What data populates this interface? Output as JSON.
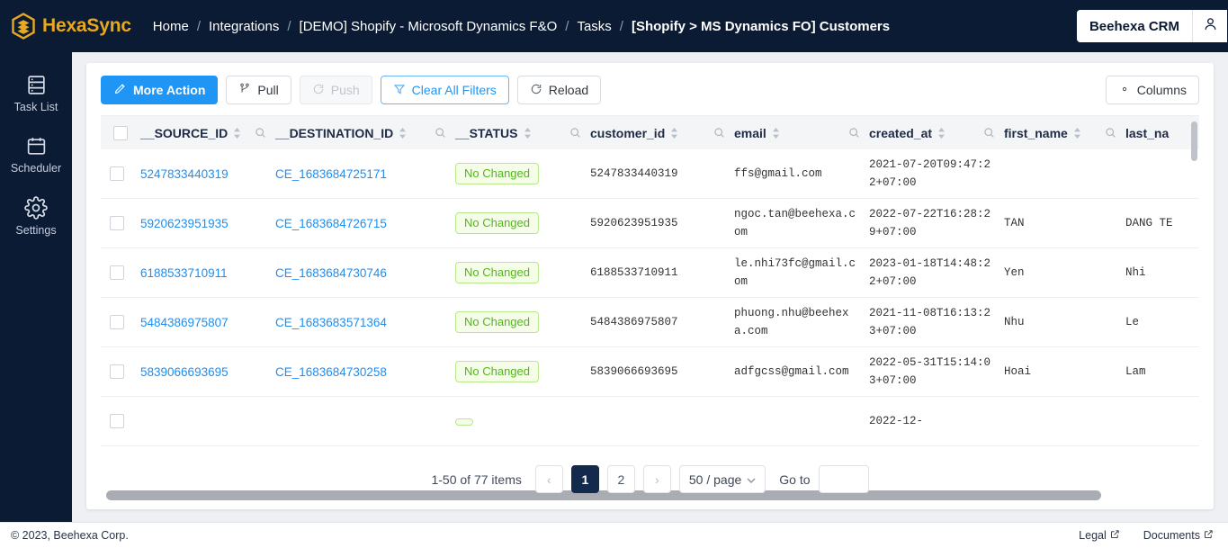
{
  "brand": {
    "name": "HexaSync",
    "logo_icon": "hexagon-layers-icon",
    "color": "#e8a820"
  },
  "breadcrumb": {
    "separator": "/",
    "items": [
      {
        "label": "Home",
        "current": false
      },
      {
        "label": "Integrations",
        "current": false
      },
      {
        "label": "[DEMO] Shopify - Microsoft Dynamics F&O",
        "current": false
      },
      {
        "label": "Tasks",
        "current": false
      },
      {
        "label": "[Shopify > MS Dynamics FO] Customers",
        "current": true
      }
    ]
  },
  "account": {
    "name": "Beehexa CRM",
    "avatar_icon": "user-icon"
  },
  "sidebar": {
    "items": [
      {
        "label": "Task List",
        "icon": "task-list-icon"
      },
      {
        "label": "Scheduler",
        "icon": "calendar-icon"
      },
      {
        "label": "Settings",
        "icon": "gear-icon"
      }
    ]
  },
  "toolbar": {
    "more_action": {
      "label": "More Action",
      "icon": "pen-icon"
    },
    "pull": {
      "label": "Pull",
      "icon": "branch-icon"
    },
    "push": {
      "label": "Push",
      "icon": "refresh-icon",
      "disabled": true
    },
    "clear_filters": {
      "label": "Clear All Filters",
      "icon": "filter-icon"
    },
    "reload": {
      "label": "Reload",
      "icon": "reload-icon"
    },
    "columns": {
      "label": "Columns",
      "icon": "gear-icon"
    }
  },
  "table": {
    "sort_icon": "sort-icon",
    "search_icon": "search-icon",
    "columns": [
      {
        "key": "source_id",
        "label": "__SOURCE_ID"
      },
      {
        "key": "destination_id",
        "label": "__DESTINATION_ID"
      },
      {
        "key": "status",
        "label": "__STATUS"
      },
      {
        "key": "customer_id",
        "label": "customer_id"
      },
      {
        "key": "email",
        "label": "email"
      },
      {
        "key": "created_at",
        "label": "created_at"
      },
      {
        "key": "first_name",
        "label": "first_name"
      },
      {
        "key": "last_name",
        "label": "last_na"
      }
    ],
    "rows": [
      {
        "source_id": "5247833440319",
        "destination_id": "CE_1683684725171",
        "status": "No Changed",
        "customer_id": "5247833440319",
        "email": "ffs@gmail.com",
        "created_at": "2021-07-20T09:47:22+07:00",
        "first_name": "",
        "last_name": ""
      },
      {
        "source_id": "5920623951935",
        "destination_id": "CE_1683684726715",
        "status": "No Changed",
        "customer_id": "5920623951935",
        "email": "ngoc.tan@beehexa.com",
        "created_at": "2022-07-22T16:28:29+07:00",
        "first_name": "TAN",
        "last_name": "DANG TE"
      },
      {
        "source_id": "6188533710911",
        "destination_id": "CE_1683684730746",
        "status": "No Changed",
        "customer_id": "6188533710911",
        "email": "le.nhi73fc@gmail.com",
        "created_at": "2023-01-18T14:48:22+07:00",
        "first_name": "Yen",
        "last_name": "Nhi"
      },
      {
        "source_id": "5484386975807",
        "destination_id": "CE_1683683571364",
        "status": "No Changed",
        "customer_id": "5484386975807",
        "email": "phuong.nhu@beehexa.com",
        "created_at": "2021-11-08T16:13:23+07:00",
        "first_name": "Nhu",
        "last_name": "Le"
      },
      {
        "source_id": "5839066693695",
        "destination_id": "CE_1683684730258",
        "status": "No Changed",
        "customer_id": "5839066693695",
        "email": "adfgcss@gmail.com",
        "created_at": "2022-05-31T15:14:03+07:00",
        "first_name": "Hoai",
        "last_name": "Lam"
      },
      {
        "source_id": "",
        "destination_id": "",
        "status": "",
        "customer_id": "",
        "email": "",
        "created_at": "2022-12-",
        "first_name": "",
        "last_name": ""
      }
    ]
  },
  "pagination": {
    "info": "1-50 of 77 items",
    "prev_label": "‹",
    "next_label": "›",
    "pages": [
      "1",
      "2"
    ],
    "active_page": "1",
    "page_size": "50 / page",
    "goto_label": "Go to",
    "goto_value": ""
  },
  "footer": {
    "copyright": "© 2023, Beehexa Corp.",
    "links": [
      {
        "label": "Legal",
        "icon": "external-link-icon"
      },
      {
        "label": "Documents",
        "icon": "external-link-icon"
      }
    ]
  }
}
